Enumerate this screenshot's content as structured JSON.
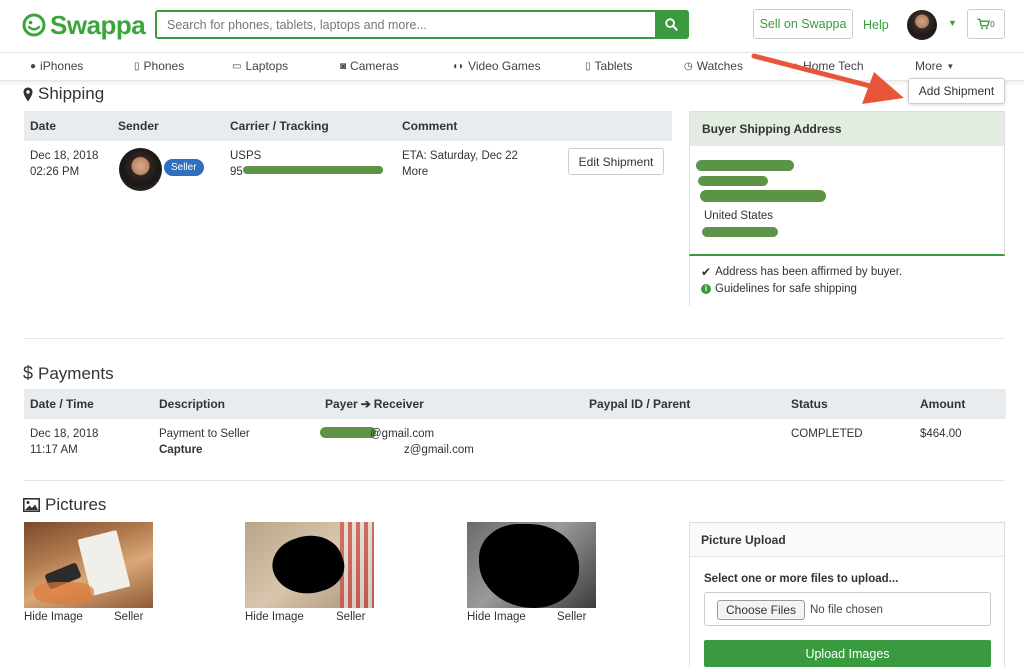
{
  "header": {
    "brand": "Swappa",
    "search_placeholder": "Search for phones, tablets, laptops and more...",
    "sell_label": "Sell on Swappa",
    "help_label": "Help",
    "cart_count": "0"
  },
  "nav": {
    "items": [
      "iPhones",
      "Phones",
      "Laptops",
      "Cameras",
      "Video Games",
      "Tablets",
      "Watches",
      "Home Tech",
      "More"
    ]
  },
  "shipping": {
    "title": "Shipping",
    "add_shipment": "Add Shipment",
    "columns": [
      "Date",
      "Sender",
      "Carrier / Tracking",
      "Comment"
    ],
    "row": {
      "date": "Dec 18, 2018",
      "time": "02:26 PM",
      "badge": "Seller",
      "carrier": "USPS",
      "tracking_prefix": "95",
      "eta": "ETA: Saturday, Dec 22",
      "more": "More",
      "edit_button": "Edit Shipment"
    },
    "buyer_panel": {
      "heading": "Buyer Shipping Address",
      "country": "United States",
      "affirmed": "Address has been affirmed by buyer.",
      "guidelines": "Guidelines for safe shipping"
    }
  },
  "payments": {
    "title": "Payments",
    "columns": [
      "Date / Time",
      "Description",
      "Payer",
      "Receiver",
      "Paypal ID / Parent",
      "Status",
      "Amount"
    ],
    "row": {
      "date": "Dec 18, 2018",
      "time": "11:17 AM",
      "description": "Payment to Seller",
      "type": "Capture",
      "payer_email": "@gmail.com",
      "receiver_email": "z@gmail.com",
      "status": "COMPLETED",
      "amount": "$464.00"
    }
  },
  "pictures": {
    "title": "Pictures",
    "items": [
      {
        "hide": "Hide Image",
        "role": "Seller"
      },
      {
        "hide": "Hide Image",
        "role": "Seller"
      },
      {
        "hide": "Hide Image",
        "role": "Seller"
      }
    ],
    "upload_panel": {
      "heading": "Picture Upload",
      "instruction": "Select one or more files to upload...",
      "choose_button": "Choose Files",
      "no_file": "No file chosen",
      "upload_button": "Upload Images"
    }
  },
  "colors": {
    "brand_green": "#3a9a40",
    "annotation_arrow": "#e8563a",
    "badge_blue": "#2f6fbd"
  }
}
